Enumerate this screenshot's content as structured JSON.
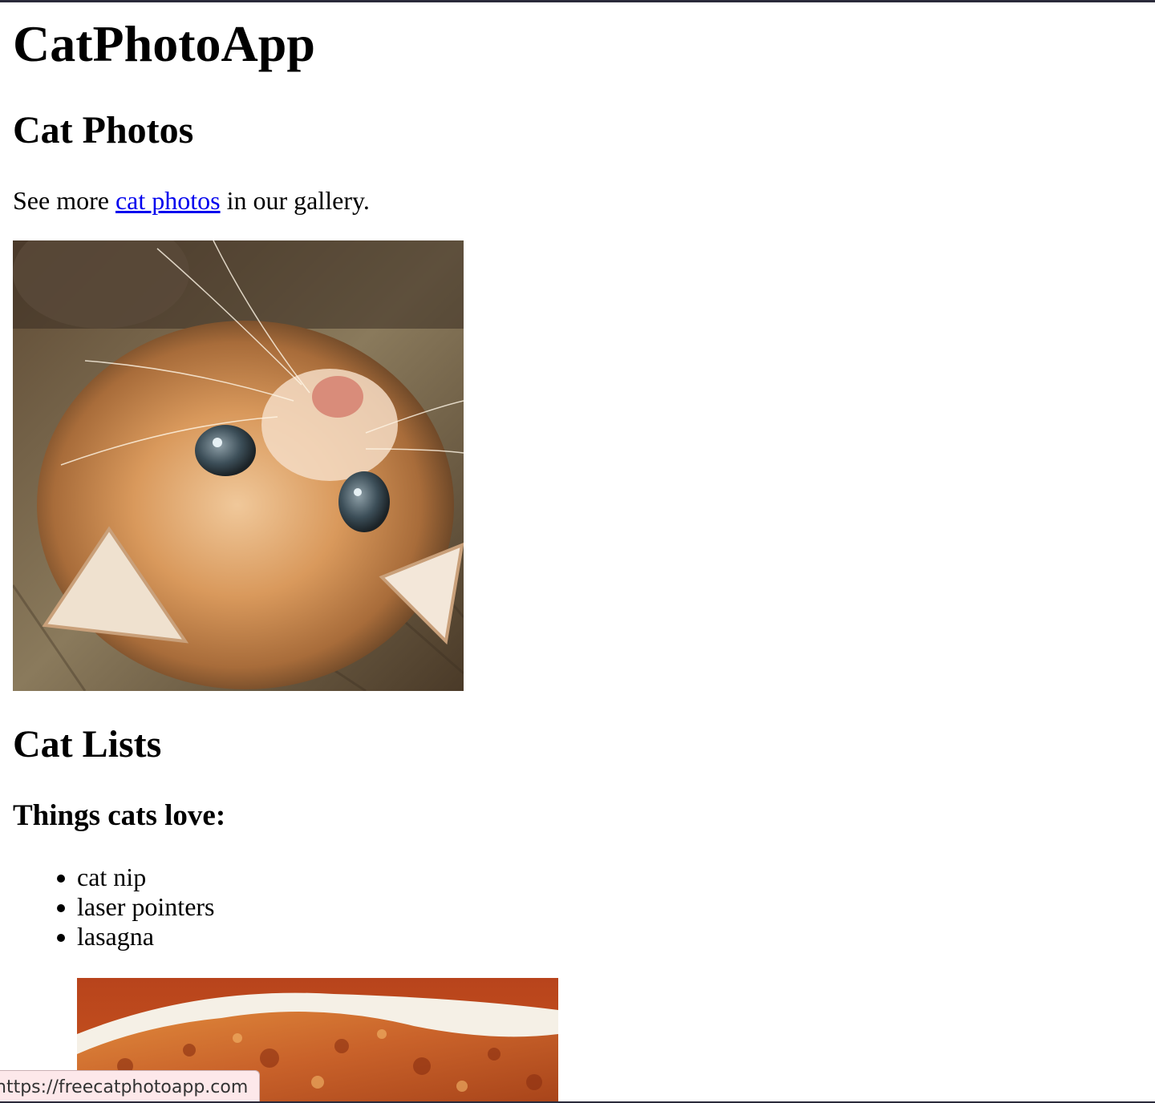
{
  "page": {
    "title": "CatPhotoApp"
  },
  "section_photos": {
    "heading": "Cat Photos",
    "intro_before": "See more ",
    "link_text": "cat photos",
    "intro_after": " in our gallery.",
    "image_alt": "A cute orange cat lying on its back.",
    "image_icon": "cat-photo"
  },
  "section_lists": {
    "heading": "Cat Lists",
    "subheading": "Things cats love:",
    "items": [
      "cat nip",
      "laser pointers",
      "lasagna"
    ],
    "image_alt": "A slice of lasagna on a plate.",
    "image_icon": "lasagna-photo"
  },
  "status_bar": {
    "url": "https://freecatphotoapp.com"
  },
  "colors": {
    "link": "#0000ee",
    "tooltip_bg": "#fde8ea",
    "border": "#2a2a3a"
  }
}
